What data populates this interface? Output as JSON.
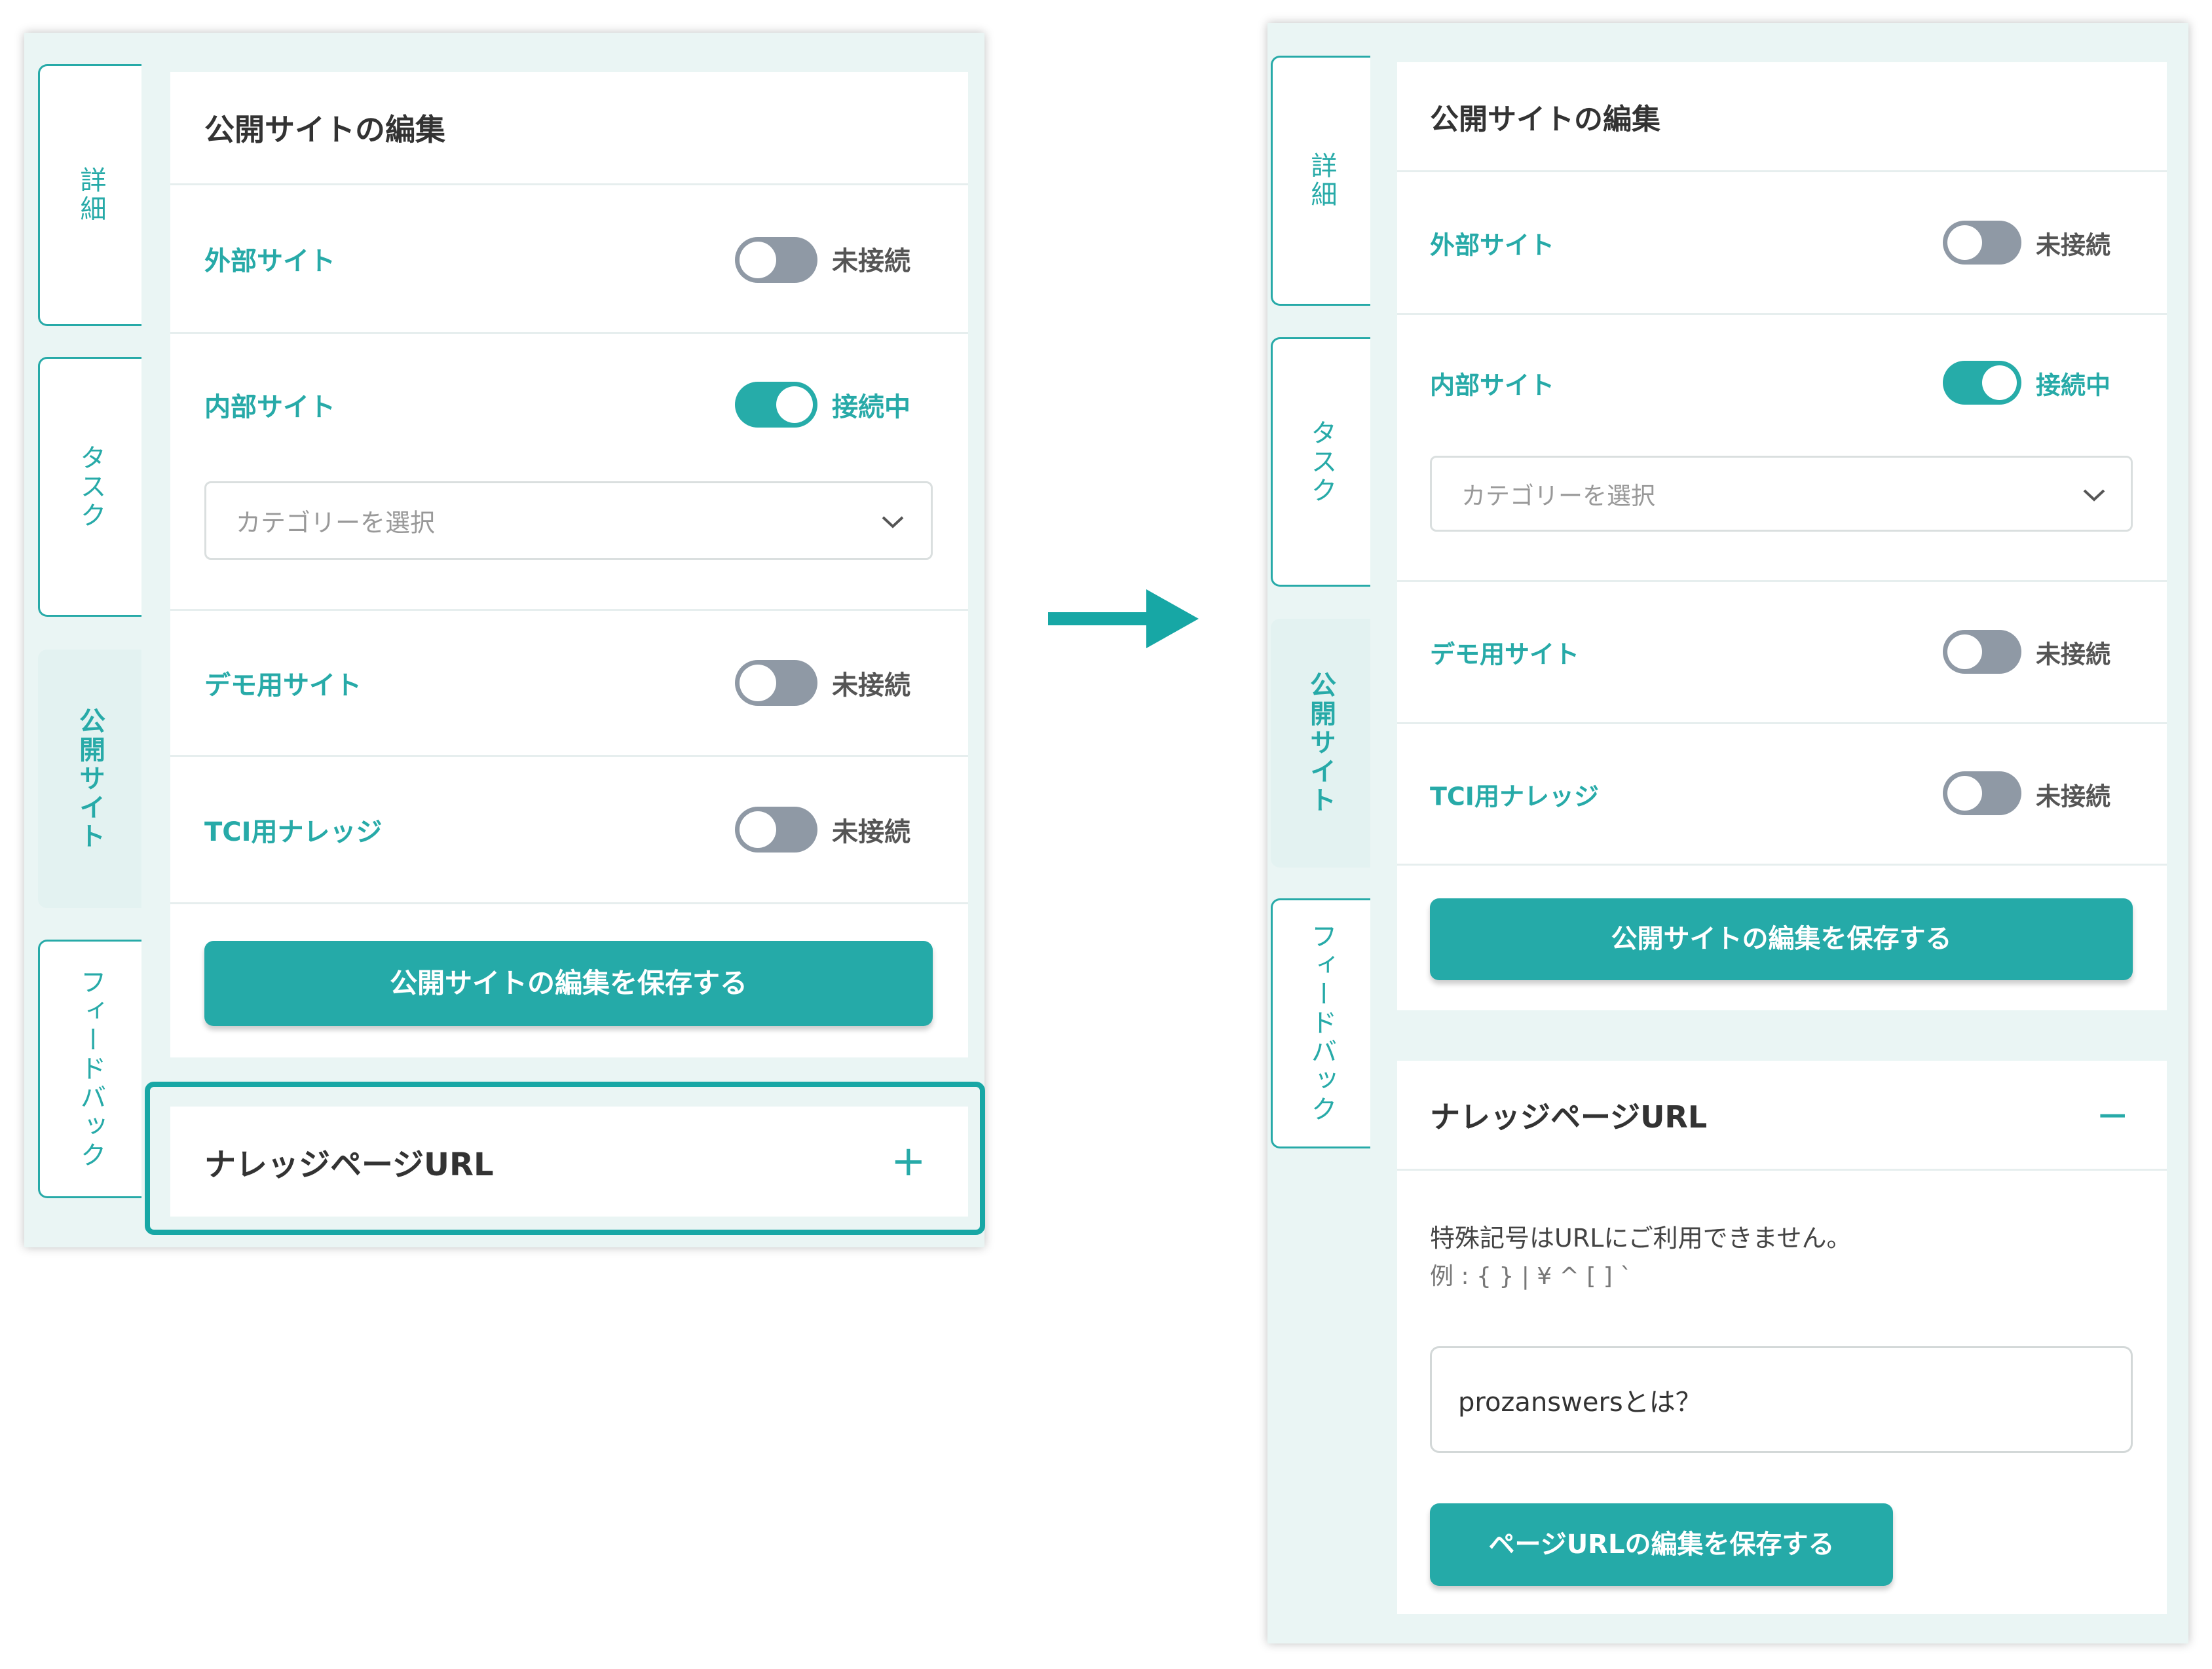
{
  "tabs": {
    "detail": "詳細",
    "task": "タスク",
    "public_site": "公開サイト",
    "feedback": "フィードバック"
  },
  "editor": {
    "title": "公開サイトの編集",
    "sites": [
      {
        "label": "外部サイト",
        "state": "off",
        "status": "未接続"
      },
      {
        "label": "内部サイト",
        "state": "on",
        "status": "接続中"
      },
      {
        "label": "デモ用サイト",
        "state": "off",
        "status": "未接続"
      },
      {
        "label": "TCI用ナレッジ",
        "state": "off",
        "status": "未接続"
      }
    ],
    "category_placeholder": "カテゴリーを選択",
    "save_button": "公開サイトの編集を保存する"
  },
  "knowledge": {
    "title": "ナレッジページURL",
    "expand_symbol": "+",
    "collapse_symbol": "−",
    "notice": "特殊記号はURLにご利用できません。",
    "example": "例 : { } | ¥ ^ [ ] `",
    "url_value": "prozanswersとは？",
    "save_button": "ページURLの編集を保存する"
  },
  "colors": {
    "accent": "#27aaa8",
    "toggle_off": "#8f99a5",
    "panel_bg": "#eaf5f4"
  }
}
